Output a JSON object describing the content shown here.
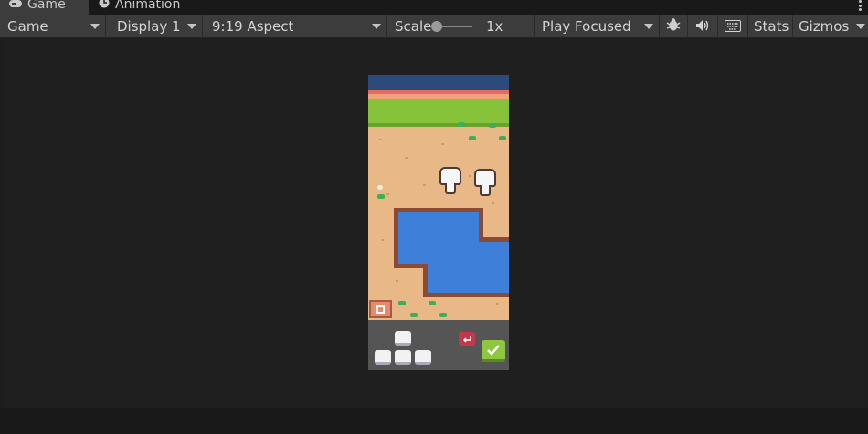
{
  "tabs": [
    {
      "label": "Game",
      "icon": "gamepad-icon",
      "active": true
    },
    {
      "label": "Animation",
      "icon": "clock-icon",
      "active": false
    }
  ],
  "toolbar": {
    "view_mode": "Game",
    "display": "Display 1",
    "aspect": "9:19 Aspect",
    "scale_label": "Scale",
    "scale_value": "1x",
    "play_mode": "Play Focused",
    "stats_label": "Stats",
    "gizmos_label": "Gizmos"
  },
  "icons": {
    "bug": "bug-icon",
    "audio": "speaker-icon",
    "keyboard": "keyboard-icon",
    "more": "kebab-menu-icon"
  },
  "colors": {
    "toolbar_bg": "#3c3c3c",
    "view_bg": "#1f1f1f",
    "grass": "#86c23a",
    "water": "#3d7fd9",
    "sand": "#e8b886"
  }
}
